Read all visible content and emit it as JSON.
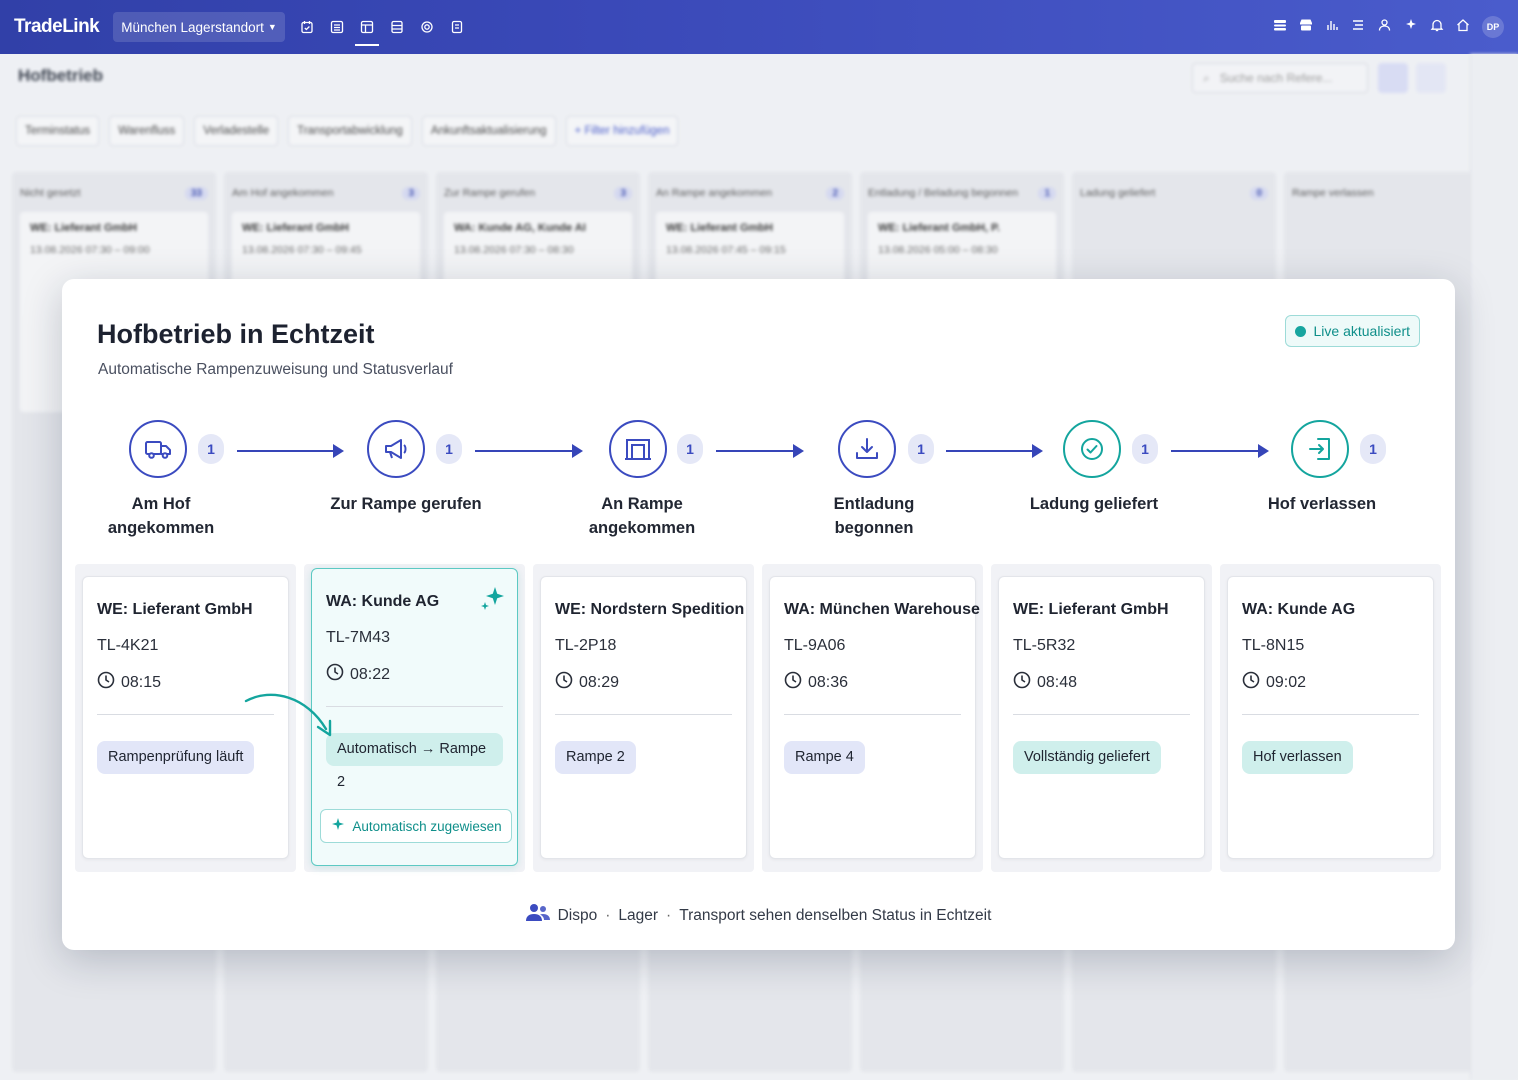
{
  "app": {
    "logo": "TradeLink",
    "site": "München Lagerstandort",
    "user_initials": "DP"
  },
  "background": {
    "page_title": "Hofbetrieb",
    "search_placeholder": "Suche nach Refere...",
    "filters": [
      "Terminstatus",
      "Warenfluss",
      "Verladestelle",
      "Transportabwicklung",
      "Ankunftsaktualisierung",
      "+ Filter hinzufügen"
    ],
    "columns": [
      {
        "title": "Nicht gesetzt",
        "count": "33",
        "card_title": "WE: Lieferant GmbH",
        "card_time": "13.08.2026 07:30 – 09:00"
      },
      {
        "title": "Am Hof angekommen",
        "count": "3",
        "card_title": "WE: Lieferant GmbH",
        "card_time": "13.08.2026 07:30 – 09:45"
      },
      {
        "title": "Zur Rampe gerufen",
        "count": "3",
        "card_title": "WA: Kunde AG, Kunde AI",
        "card_time": "13.08.2026 07:30 – 08:30"
      },
      {
        "title": "An Rampe angekommen",
        "count": "2",
        "card_title": "WE: Lieferant GmbH",
        "card_time": "13.08.2026 07:45 – 09:15"
      },
      {
        "title": "Entladung / Beladung begonnen",
        "count": "1",
        "card_title": "WE: Lieferant GmbH, P.",
        "card_time": "13.08.2026 05:00 – 08:30"
      },
      {
        "title": "Ladung geliefert",
        "count": "0",
        "card_title": "",
        "card_time": ""
      },
      {
        "title": "Rampe verlassen",
        "count": "",
        "card_title": "",
        "card_time": ""
      }
    ]
  },
  "modal": {
    "title": "Hofbetrieb in Echtzeit",
    "subtitle": "Automatische Rampenzuweisung und Statusverlauf",
    "live_label": "Live aktualisiert",
    "stages": [
      {
        "label": "Am Hof angekommen",
        "count": "1",
        "icon": "truck-icon"
      },
      {
        "label": "Zur Rampe gerufen",
        "count": "1",
        "icon": "megaphone-icon"
      },
      {
        "label": "An Rampe angekommen",
        "count": "1",
        "icon": "dock-door-icon"
      },
      {
        "label": "Entladung begonnen",
        "count": "1",
        "icon": "download-icon"
      },
      {
        "label": "Ladung geliefert",
        "count": "1",
        "icon": "check-circle-icon"
      },
      {
        "label": "Hof verlassen",
        "count": "1",
        "icon": "exit-icon"
      }
    ],
    "cards": [
      {
        "title": "WE: Lieferant GmbH",
        "id": "TL-4K21",
        "time": "08:15",
        "status": "Rampenprüfung läuft"
      },
      {
        "title": "WA: Kunde AG",
        "id": "TL-7M43",
        "time": "08:22",
        "status": "Automatisch → Rampe 2",
        "badge": "Automatisch zugewiesen"
      },
      {
        "title": "WE: Nordstern Spedition",
        "id": "TL-2P18",
        "time": "08:29",
        "status": "Rampe 2"
      },
      {
        "title": "WA: München Warehouse",
        "id": "TL-9A06",
        "time": "08:36",
        "status": "Rampe 4"
      },
      {
        "title": "WE: Lieferant GmbH",
        "id": "TL-5R32",
        "time": "08:48",
        "status": "Vollständig geliefert"
      },
      {
        "title": "WA: Kunde AG",
        "id": "TL-8N15",
        "time": "09:02",
        "status": "Hof verlassen"
      }
    ],
    "footer": {
      "role1": "Dispo",
      "role2": "Lager",
      "text": "Transport sehen denselben Status in Echtzeit"
    }
  },
  "colors": {
    "primary": "#3b4bc0",
    "teal": "#14a59e",
    "topbar": "#3a49b8"
  }
}
